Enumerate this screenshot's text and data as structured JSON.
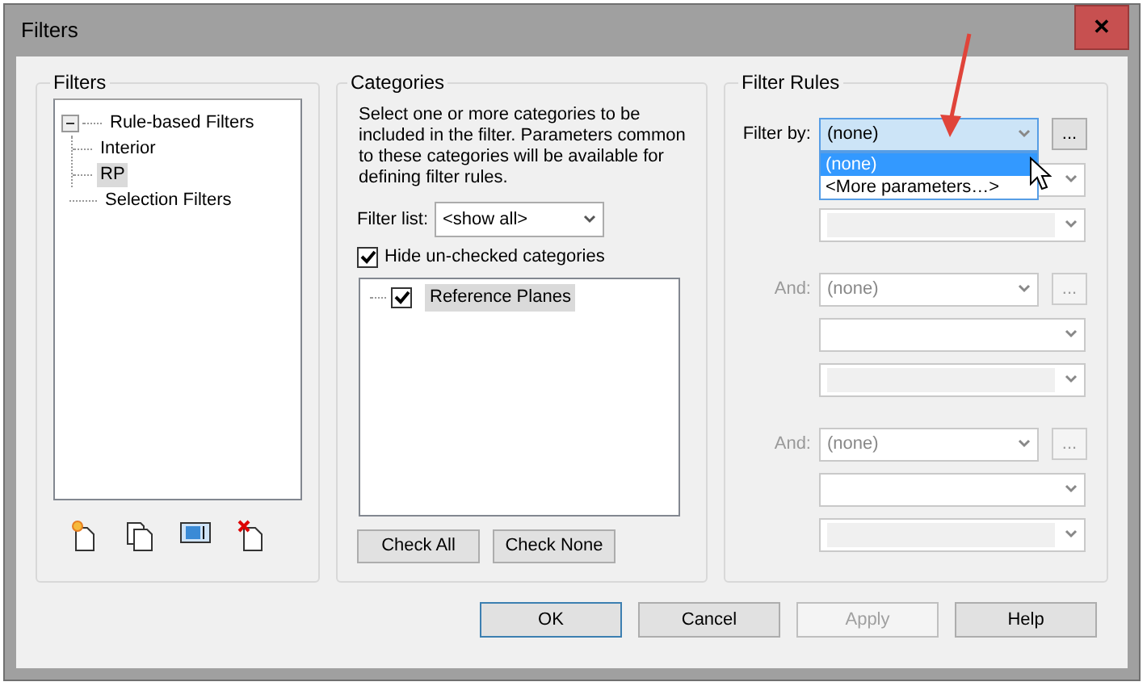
{
  "window": {
    "title": "Filters",
    "close": "✕"
  },
  "filters_panel": {
    "title": "Filters",
    "tree": [
      {
        "label": "Rule-based Filters",
        "expanded": true,
        "selected": false,
        "children": [
          {
            "label": "Interior",
            "selected": false
          },
          {
            "label": "RP",
            "selected": true
          }
        ]
      },
      {
        "label": "Selection Filters",
        "selected": false
      }
    ]
  },
  "categories_panel": {
    "title": "Categories",
    "description": "Select one or more categories to be included in the filter.  Parameters common to these categories will be available for defining filter rules.",
    "filter_list": {
      "label": "Filter list:",
      "value": "<show all>"
    },
    "hide_unchecked": {
      "label": "Hide un-checked categories",
      "checked": true
    },
    "categories": [
      {
        "label": "Reference Planes",
        "checked": true,
        "selected": true
      }
    ],
    "buttons": [
      "Check All",
      "Check None"
    ]
  },
  "filter_rules": {
    "title": "Filter Rules",
    "rules": [
      {
        "label": "Filter by:",
        "field": "(none)",
        "enabled": true,
        "open": true,
        "more": "..."
      },
      {
        "label": "And:",
        "field": "(none)",
        "enabled": false,
        "open": false,
        "more": "..."
      },
      {
        "label": "And:",
        "field": "(none)",
        "enabled": false,
        "open": false,
        "more": "..."
      }
    ],
    "dropdown_options": [
      {
        "label": "(none)",
        "selected": true
      },
      {
        "label": "<More parameters…>",
        "selected": false
      }
    ]
  },
  "buttons": [
    {
      "label": "OK",
      "default": true,
      "disabled": false
    },
    {
      "label": "Cancel",
      "default": false,
      "disabled": false
    },
    {
      "label": "Apply",
      "default": false,
      "disabled": true
    },
    {
      "label": "Help",
      "default": false,
      "disabled": false
    }
  ]
}
